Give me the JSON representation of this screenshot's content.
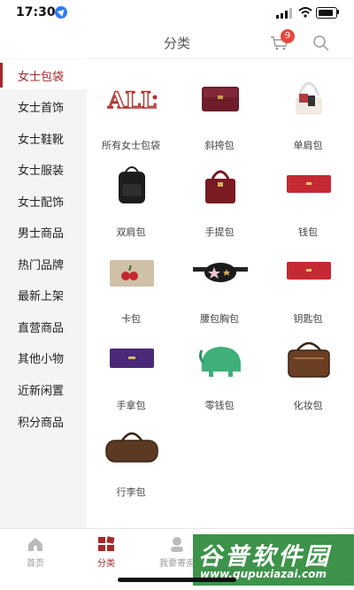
{
  "status_bar": {
    "time": "17:30"
  },
  "header": {
    "title": "分类",
    "cart_badge": "9"
  },
  "sidebar": {
    "items": [
      {
        "label": "女士包袋",
        "active": true
      },
      {
        "label": "女士首饰"
      },
      {
        "label": "女士鞋靴"
      },
      {
        "label": "女士服装"
      },
      {
        "label": "女士配饰"
      },
      {
        "label": "男士商品"
      },
      {
        "label": "热门品牌"
      },
      {
        "label": "最新上架"
      },
      {
        "label": "直营商品"
      },
      {
        "label": "其他小物"
      },
      {
        "label": "近新闲置"
      },
      {
        "label": "积分商品"
      }
    ]
  },
  "categories": [
    {
      "label": "所有女士包袋"
    },
    {
      "label": "斜挎包"
    },
    {
      "label": "单肩包"
    },
    {
      "label": "双肩包"
    },
    {
      "label": "手提包"
    },
    {
      "label": "钱包"
    },
    {
      "label": "卡包"
    },
    {
      "label": "腰包胸包"
    },
    {
      "label": "钥匙包"
    },
    {
      "label": "手拿包"
    },
    {
      "label": "零钱包"
    },
    {
      "label": "化妆包"
    },
    {
      "label": "行李包"
    }
  ],
  "all_bags_logo": "ALL",
  "tabbar": {
    "items": [
      {
        "label": "首页"
      },
      {
        "label": "分类",
        "active": true
      },
      {
        "label": "我要寄卖"
      }
    ]
  },
  "watermark": {
    "title": "谷普软件园",
    "url": "www.gupuxiazai.com"
  },
  "colors": {
    "accent": "#a4292a",
    "badge": "#e5483d",
    "sidebar_bg": "#f4f4f4"
  }
}
